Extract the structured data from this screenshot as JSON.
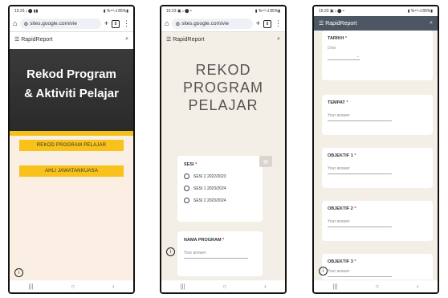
{
  "phone1": {
    "status": {
      "time": "15:23 ᵢₗ ⬤ ▮▮",
      "right": "▮ %⁴ᴳ.ıl 85%▮"
    },
    "browser": {
      "url": "sites.google.com/vie",
      "tabs_count": "8"
    },
    "appbar": {
      "title": "RapidReport"
    },
    "hero": {
      "title_line1": "Rekod Program",
      "title_line2": "& Aktiviti Pelajar"
    },
    "buttons": [
      "REKOD PROGRAM PELAJAR",
      "AHLI JAWATANKUASA"
    ]
  },
  "phone2": {
    "status": {
      "time": "15:23 ▣ ᵢₗ ⬤ •",
      "right": "▮ %⁴ᴳ.ıl 85%▮"
    },
    "browser": {
      "url": "sites.google.com/vie",
      "tabs_count": "8"
    },
    "appbar": {
      "title": "RapidReport"
    },
    "title_lines": [
      "REKOD",
      "PROGRAM",
      "PELAJAR"
    ],
    "sesi": {
      "label": "SESI",
      "options": [
        "SESI 2 2022/2023",
        "SESI 1 2023/2024",
        "SESI 2 2023/2024"
      ]
    },
    "nama_program": {
      "label": "NAMA PROGRAM",
      "placeholder": "Your answer"
    }
  },
  "phone3": {
    "status": {
      "time": "15:23 ▣ ᵢₗ ⬤ •",
      "right": "▮ %⁴ᴳ.ıl 85%▮"
    },
    "appbar": {
      "title": "RapidReport"
    },
    "tarikh": {
      "label": "TARIKH",
      "sub": "Date"
    },
    "tempat": {
      "label": "TEMPAT",
      "placeholder": "Your answer"
    },
    "objektif1": {
      "label": "OBJEKTIF 1",
      "placeholder": "Your answer"
    },
    "objektif2": {
      "label": "OBJEKTIF 2",
      "placeholder": "Your answer"
    },
    "objektif3": {
      "label": "OBJEKTIF 3",
      "placeholder": "Your answer"
    }
  },
  "required_mark": "*",
  "colors": {
    "yellow": "#f8c21b",
    "hero": "#2f2f2f",
    "form_bg": "#f3efe7",
    "appbar_dark": "#4d5663"
  }
}
